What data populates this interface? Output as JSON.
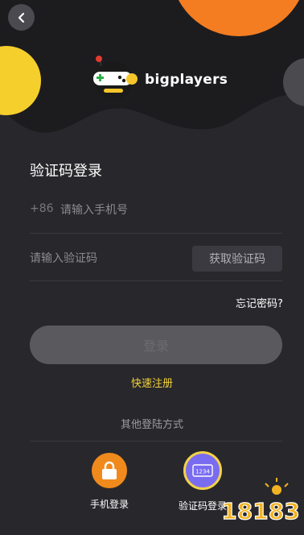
{
  "header": {
    "app_name": "bigplayers"
  },
  "page": {
    "title": "验证码登录"
  },
  "form": {
    "phone_prefix": "+86",
    "phone_placeholder": "请输入手机号",
    "code_placeholder": "请输入验证码",
    "get_code_label": "获取验证码",
    "forgot_password": "忘记密码?",
    "login_label": "登录",
    "register_label": "快速注册"
  },
  "other_login": {
    "label": "其他登陆方式",
    "options": [
      {
        "label": "手机登录",
        "icon": "lock-icon"
      },
      {
        "label": "验证码登录",
        "icon": "code-card-icon",
        "card_text": "1234"
      }
    ]
  },
  "watermark": {
    "text": "18183"
  },
  "colors": {
    "background": "#28282c",
    "accent_yellow": "#f5d23a",
    "orange": "#f08a1c",
    "purple": "#7a6cf0"
  }
}
